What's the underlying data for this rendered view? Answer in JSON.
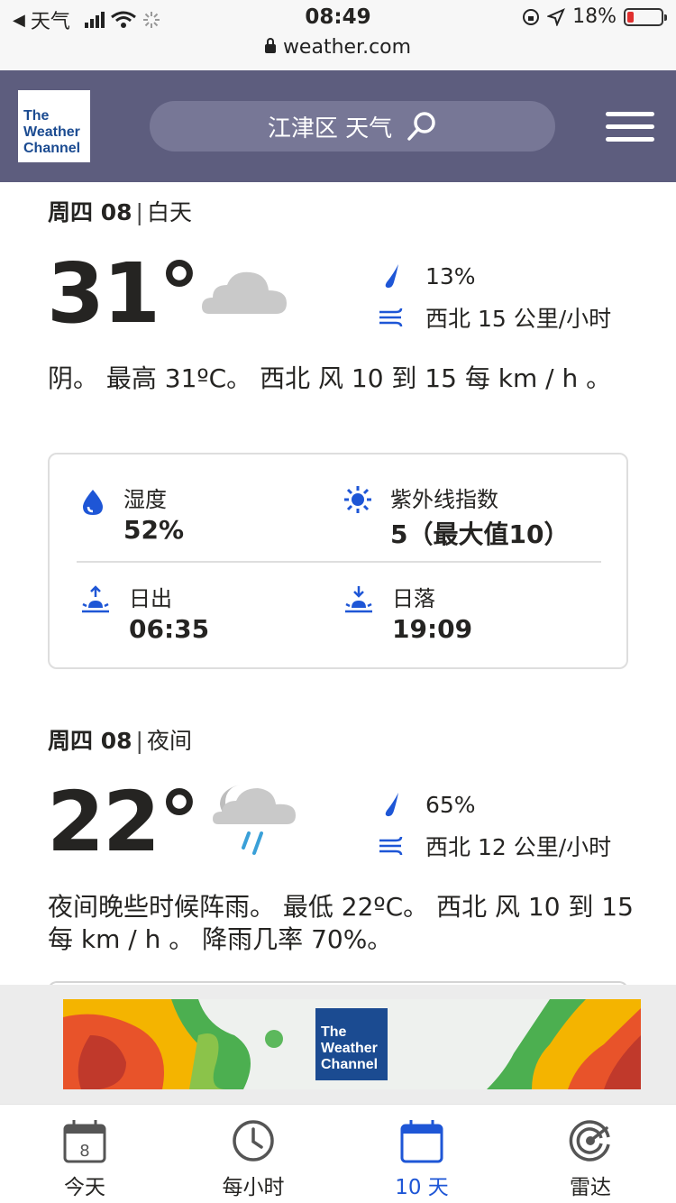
{
  "status_bar": {
    "back_app": "天气",
    "time": "08:49",
    "battery": "18%",
    "url": "weather.com"
  },
  "header": {
    "logo_text": [
      "The",
      "Weather",
      "Channel"
    ],
    "search_text": "江津区 天气",
    "brand_color": "#5d5d7e"
  },
  "day": {
    "date": "周四 08",
    "part": "白天",
    "temp": "31°",
    "precip": "13%",
    "wind": "西北 15 公里/小时",
    "narrative": "阴。 最高 31ºC。 西北 风 10 到 15 每 km / h 。",
    "icon": "cloudy-icon"
  },
  "details": {
    "humidity_label": "湿度",
    "humidity_value": "52%",
    "uv_label": "紫外线指数",
    "uv_value": "5（最大值10）",
    "sunrise_label": "日出",
    "sunrise_value": "06:35",
    "sunset_label": "日落",
    "sunset_value": "19:09"
  },
  "night": {
    "date": "周四 08",
    "part": "夜间",
    "temp": "22°",
    "precip": "65%",
    "wind": "西北 12 公里/小时",
    "narrative": "夜间晚些时候阵雨。 最低 22ºC。 西北 风 10 到 15 每 km / h 。 降雨几率 70%。",
    "icon": "night-rain-icon"
  },
  "ad": {
    "logo_text": [
      "The",
      "Weather",
      "Channel"
    ]
  },
  "tabs": [
    {
      "label": "今天",
      "icon": "calendar-day-icon",
      "badge": "8"
    },
    {
      "label": "每小时",
      "icon": "clock-icon"
    },
    {
      "label": "10 天",
      "icon": "calendar-icon",
      "active": true
    },
    {
      "label": "雷达",
      "icon": "radar-icon"
    }
  ],
  "colors": {
    "accent_blue": "#1e56d6",
    "text": "#252422"
  }
}
